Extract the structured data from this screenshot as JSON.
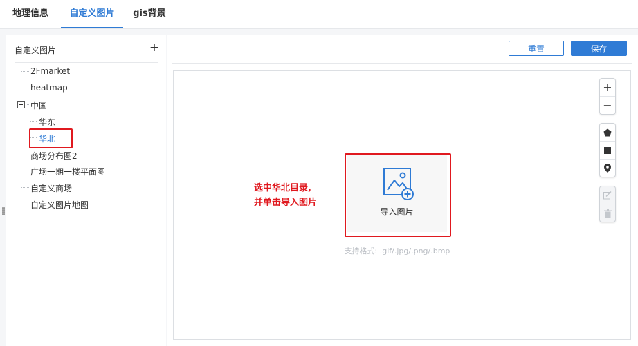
{
  "tabs": [
    {
      "label": "地理信息",
      "active": false
    },
    {
      "label": "自定义图片",
      "active": true
    },
    {
      "label": "gis背景",
      "active": false
    }
  ],
  "sidebar": {
    "title": "自定义图片",
    "add_label": "+",
    "items": [
      {
        "label": "2Fmarket"
      },
      {
        "label": "heatmap"
      },
      {
        "label": "中国",
        "expanded": true
      },
      {
        "label": "华东"
      },
      {
        "label": "华北",
        "selected": true
      },
      {
        "label": "商场分布图2"
      },
      {
        "label": "广场一期一楼平面图"
      },
      {
        "label": "自定义商场"
      },
      {
        "label": "自定义图片地图"
      }
    ]
  },
  "toolbar": {
    "reset_label": "重置",
    "save_label": "保存"
  },
  "canvas": {
    "import_label": "导入图片",
    "formats_hint": "支持格式: .gif/.jpg/.png/.bmp",
    "annotation_line1": "选中华北目录,",
    "annotation_line2": "并单击导入图片"
  },
  "map_tools": {
    "zoom_in": "+",
    "zoom_out": "−",
    "icons": [
      "pentagon-icon",
      "square-icon",
      "location-pin-icon",
      "edit-icon",
      "trash-icon"
    ]
  },
  "colors": {
    "accent": "#2f7bd5",
    "annotation": "#e0191f"
  }
}
